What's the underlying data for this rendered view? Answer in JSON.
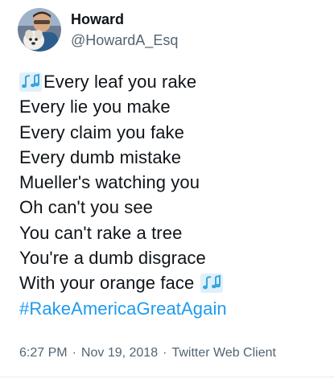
{
  "author": {
    "display_name": "Howard",
    "handle": "@HowardA_Esq"
  },
  "tweet": {
    "lines": [
      "Every leaf you rake",
      "Every lie you make",
      "Every claim you fake",
      "Every dumb mistake",
      "Mueller's watching you",
      "Oh can't you see",
      "You can't rake a tree",
      "You're a dumb disgrace",
      "With your orange face"
    ],
    "hashtag": "#RakeAmericaGreatAgain",
    "emoji": "music-notes-icon"
  },
  "meta": {
    "time": "6:27 PM",
    "date": "Nov 19, 2018",
    "source": "Twitter Web Client",
    "separator": "·"
  },
  "colors": {
    "text": "#0f1419",
    "secondary": "#536471",
    "link": "#1d9bf0",
    "emoji_blue": "#3aa5dd"
  }
}
